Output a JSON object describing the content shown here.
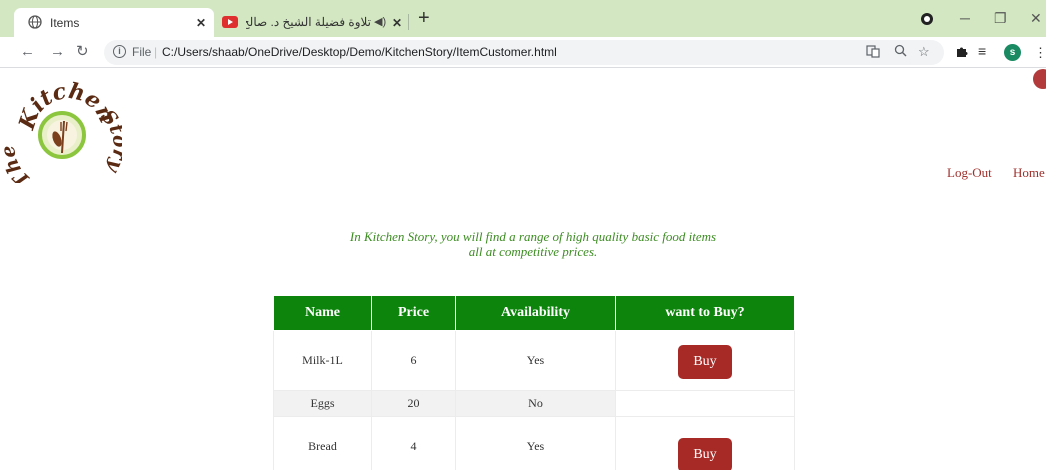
{
  "browser": {
    "active_tab": {
      "title": "Items"
    },
    "inactive_tab": {
      "title": "تلاوة فضيلة الشيخ د. صالح بن"
    },
    "address": {
      "scheme_label": "File",
      "url": "C:/Users/shaab/OneDrive/Desktop/Demo/KitchenStory/ItemCustomer.html"
    },
    "profile_initial": "s"
  },
  "page": {
    "logo": {
      "text_top": "Kitchen",
      "text_left": "The",
      "text_right": "Story"
    },
    "nav": {
      "logout": "Log-Out",
      "home": "Home"
    },
    "tagline": {
      "line1": "In Kitchen Story, you will find a range of high quality basic food items",
      "line2": "all at competitive prices."
    },
    "table": {
      "headers": [
        "Name",
        "Price",
        "Availability",
        "want to Buy?"
      ],
      "rows": [
        {
          "name": "Milk-1L",
          "price": "6",
          "availability": "Yes",
          "action": "Buy"
        },
        {
          "name": "Eggs",
          "price": "20",
          "availability": "No",
          "action": ""
        },
        {
          "name": "Bread",
          "price": "4",
          "availability": "Yes",
          "action": "Buy"
        }
      ]
    }
  },
  "colors": {
    "tab_strip": "#d3e8c2",
    "header_green": "#0d850d",
    "buy_red": "#a82a26",
    "tagline_green": "#3c8c22",
    "link_red": "#a0312d"
  }
}
